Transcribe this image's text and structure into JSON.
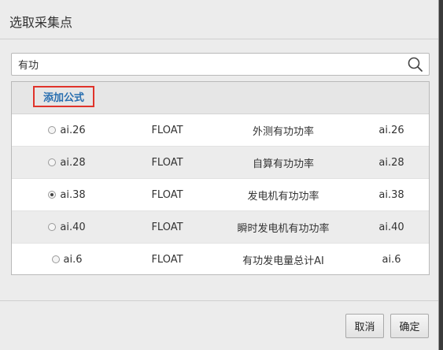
{
  "dialog": {
    "title": "选取采集点"
  },
  "search": {
    "value": "有功",
    "icon": "search-icon"
  },
  "table": {
    "add_formula_label": "添加公式",
    "rows": [
      {
        "id": "ai.26",
        "type": "FLOAT",
        "name": "外测有功功率",
        "code": "ai.26",
        "selected": false
      },
      {
        "id": "ai.28",
        "type": "FLOAT",
        "name": "自算有功功率",
        "code": "ai.28",
        "selected": false
      },
      {
        "id": "ai.38",
        "type": "FLOAT",
        "name": "发电机有功功率",
        "code": "ai.38",
        "selected": true
      },
      {
        "id": "ai.40",
        "type": "FLOAT",
        "name": "瞬时发电机有功功率",
        "code": "ai.40",
        "selected": false
      },
      {
        "id": "ai.6",
        "type": "FLOAT",
        "name": "有功发电量总计AI",
        "code": "ai.6",
        "selected": false
      }
    ]
  },
  "footer": {
    "cancel_label": "取消",
    "ok_label": "确定"
  }
}
